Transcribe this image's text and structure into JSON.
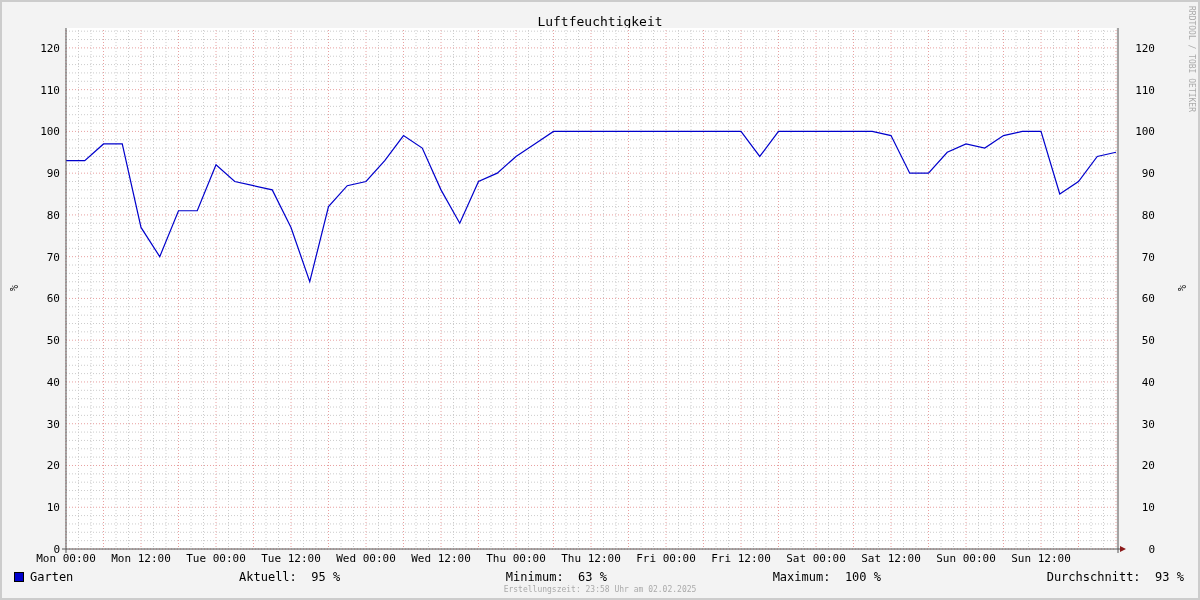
{
  "title": "Luftfeuchtigkeit",
  "side_text": "RRDTOOL / TOBI OETIKER",
  "chart_data": {
    "type": "line",
    "grid": true,
    "ylabel": "%",
    "y2label": "%",
    "ylim": [
      0,
      125
    ],
    "y2lim": [
      0,
      125
    ],
    "categories": [
      "Mon 00:00",
      null,
      null,
      null,
      "Mon 12:00",
      null,
      null,
      null,
      "Tue 00:00",
      null,
      null,
      null,
      "Tue 12:00",
      null,
      null,
      null,
      "Wed 00:00",
      null,
      null,
      null,
      "Wed 12:00",
      null,
      null,
      null,
      "Thu 00:00",
      null,
      null,
      null,
      "Thu 12:00",
      null,
      null,
      null,
      "Fri 00:00",
      null,
      null,
      null,
      "Fri 12:00",
      null,
      null,
      null,
      "Sat 00:00",
      null,
      null,
      null,
      "Sat 12:00",
      null,
      null,
      null,
      "Sun 00:00",
      null,
      null,
      null,
      "Sun 12:00",
      null,
      null,
      null,
      null
    ],
    "yticks": [
      0,
      10,
      20,
      30,
      40,
      50,
      60,
      70,
      80,
      90,
      100,
      110,
      120
    ],
    "y2ticks": [
      0,
      10,
      20,
      30,
      40,
      50,
      60,
      70,
      80,
      90,
      100,
      110,
      120
    ],
    "series": [
      {
        "name": "Garten",
        "color": "#0000cc",
        "values": [
          93,
          93,
          97,
          97,
          77,
          70,
          81,
          81,
          92,
          88,
          87,
          86,
          77,
          64,
          82,
          87,
          88,
          93,
          99,
          96,
          86,
          78,
          88,
          90,
          94,
          97,
          100,
          100,
          100,
          100,
          100,
          100,
          100,
          100,
          100,
          100,
          100,
          94,
          100,
          100,
          100,
          100,
          100,
          100,
          99,
          90,
          90,
          95,
          97,
          96,
          99,
          100,
          100,
          85,
          88,
          94,
          95
        ]
      }
    ]
  },
  "legend": {
    "stats": [
      {
        "label": "Aktuell:",
        "value": "95 %"
      },
      {
        "label": "Minimum:",
        "value": "63 %"
      },
      {
        "label": "Maximum:",
        "value": "100 %"
      },
      {
        "label": "Durchschnitt:",
        "value": "93 %"
      }
    ]
  },
  "footer": "Erstellungszeit: 23:58 Uhr am 02.02.2025"
}
